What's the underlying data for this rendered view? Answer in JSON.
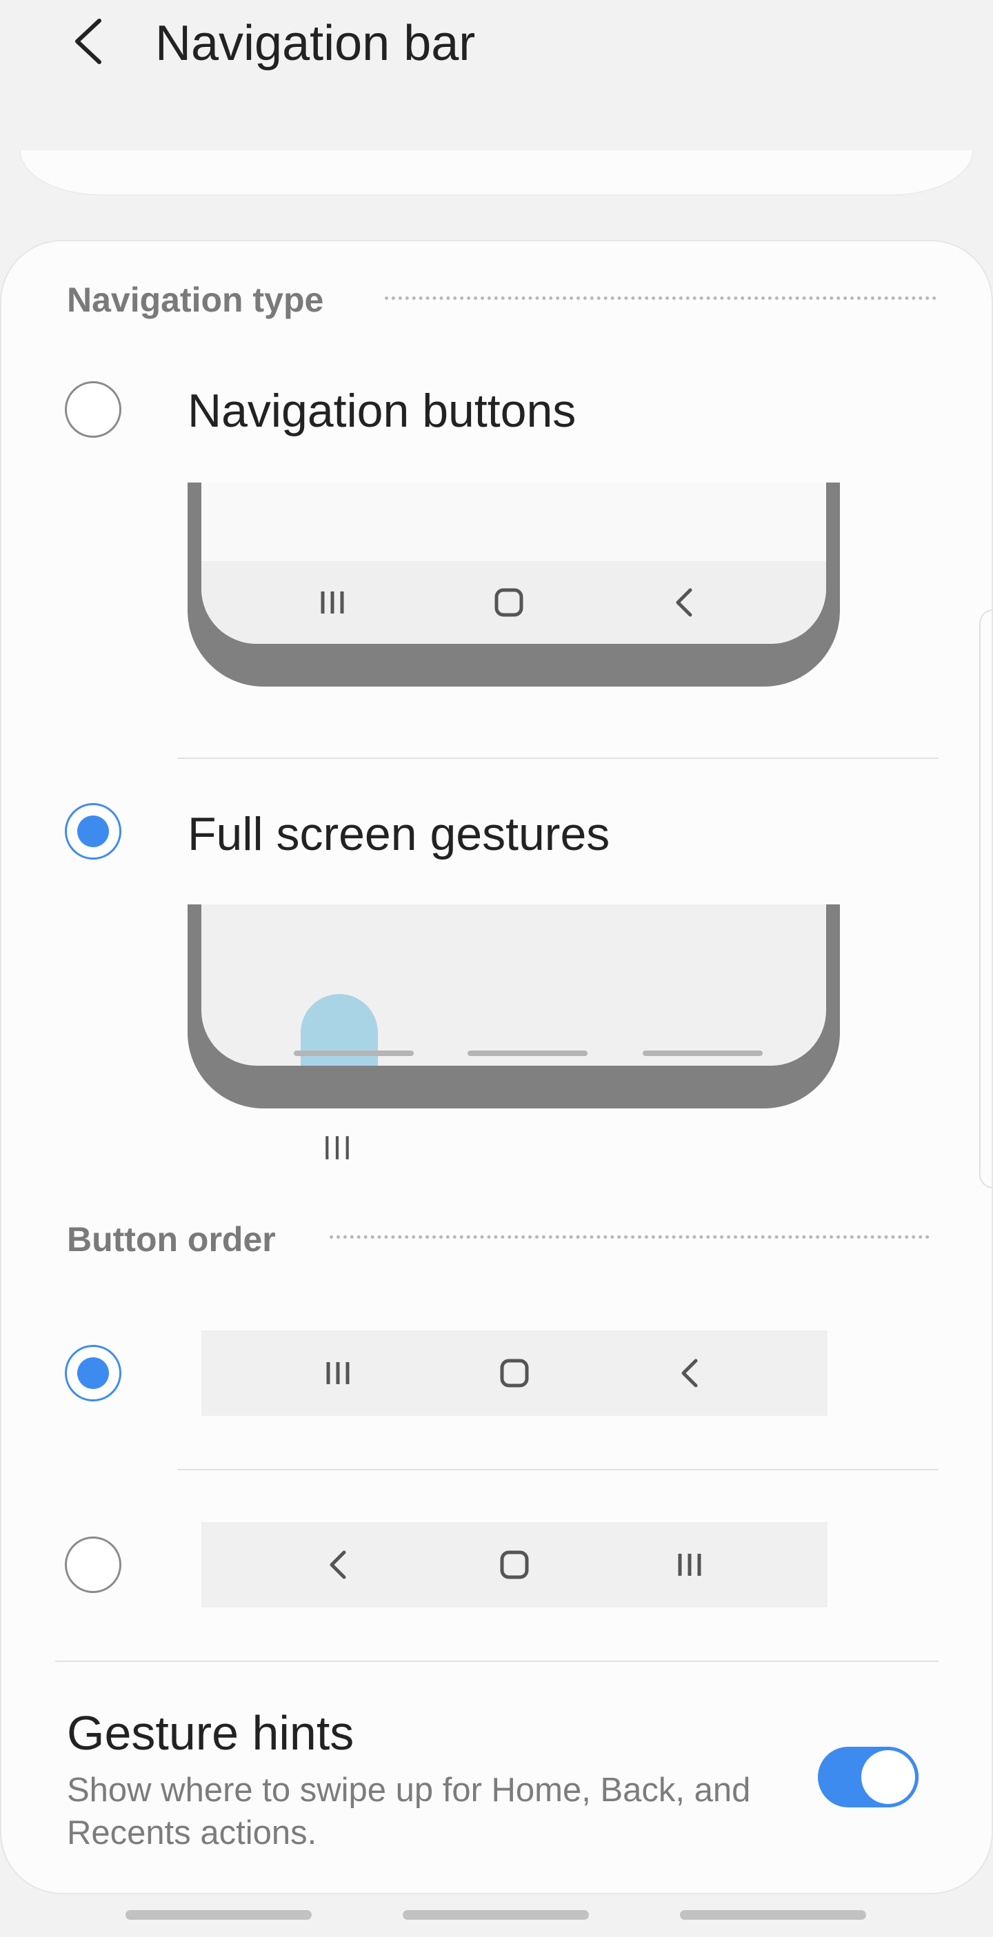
{
  "header": {
    "title": "Navigation bar",
    "back_icon": "chevron-left-icon"
  },
  "navigation_type": {
    "header": "Navigation type",
    "options": [
      {
        "label": "Navigation buttons",
        "selected": false
      },
      {
        "label": "Full screen gestures",
        "selected": true
      }
    ],
    "preview_swipe_hint_icon": "recents-icon"
  },
  "button_order": {
    "header": "Button order",
    "options": [
      {
        "order": [
          "recents-icon",
          "home-icon",
          "back-icon"
        ],
        "selected": true
      },
      {
        "order": [
          "back-icon",
          "home-icon",
          "recents-icon"
        ],
        "selected": false
      }
    ]
  },
  "gesture_hints": {
    "title": "Gesture hints",
    "description": "Show where to swipe up for Home, Back, and Recents actions.",
    "enabled": true
  },
  "colors": {
    "accent": "#3e8bf0",
    "background": "#f2f2f2",
    "card": "#fcfcfc",
    "finger_highlight": "#a9d4e6"
  }
}
